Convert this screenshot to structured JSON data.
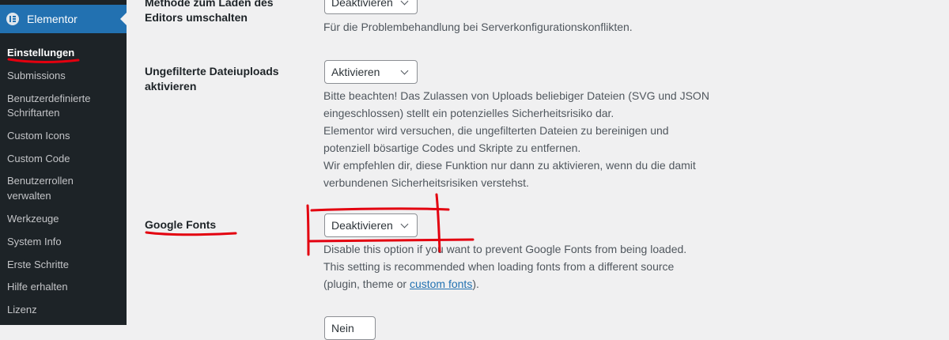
{
  "sidebar": {
    "header": "Elementor",
    "items": [
      "Einstellungen",
      "Submissions",
      "Benutzerdefinierte",
      "Schriftarten",
      "Custom Icons",
      "Custom Code",
      "Benutzerrollen",
      "verwalten",
      "Werkzeuge",
      "System Info",
      "Erste Schritte",
      "Hilfe erhalten",
      "Lizenz"
    ]
  },
  "settings": {
    "editor_method": {
      "label_line1": "Methode zum Laden des",
      "label_line2": "Editors umschalten",
      "value": "Deaktivieren",
      "description": "Für die Problembehandlung bei Serverkonfigurationskonflikten."
    },
    "unfiltered_uploads": {
      "label_line1": "Ungefilterte Dateiuploads",
      "label_line2": "aktivieren",
      "value": "Aktivieren",
      "description": [
        "Bitte beachten! Das Zulassen von Uploads beliebiger Dateien (SVG und JSON",
        "eingeschlossen) stellt ein potenzielles Sicherheitsrisiko dar.",
        "Elementor wird versuchen, die ungefilterten Dateien zu bereinigen und",
        "potenziell bösartige Codes und Skripte zu entfernen.",
        "Wir empfehlen dir, diese Funktion nur dann zu aktivieren, wenn du die damit",
        "verbundenen Sicherheitsrisiken verstehst."
      ]
    },
    "google_fonts": {
      "label": "Google Fonts",
      "value": "Deaktivieren",
      "description_line1": "Disable this option if you want to prevent Google Fonts from being loaded.",
      "description_line2": "This setting is recommended when loading fonts from a different source",
      "description_line3_prefix": "(plugin, theme or ",
      "description_link": "custom fonts",
      "description_line3_suffix": ")."
    },
    "next_setting": {
      "value": "Nein"
    }
  },
  "annotation_color": "#e3000f",
  "accent_color": "#2271b1"
}
